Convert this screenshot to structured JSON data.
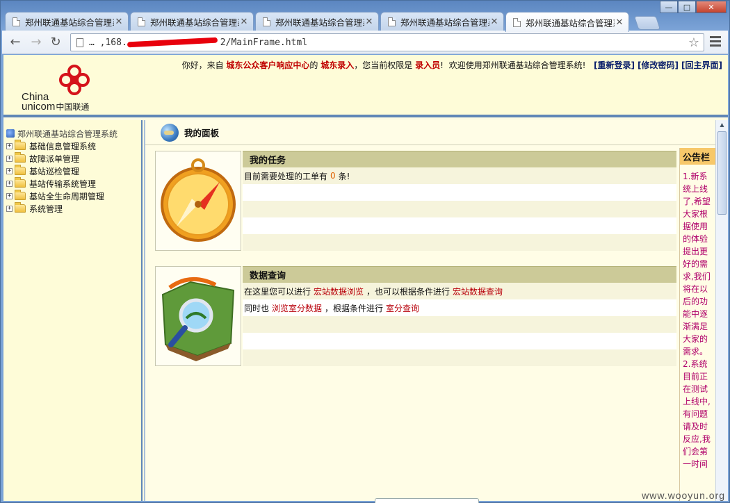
{
  "browser": {
    "tabs": [
      {
        "title": "郑州联通基站综合管理系"
      },
      {
        "title": "郑州联通基站综合管理系"
      },
      {
        "title": "郑州联通基站综合管理系"
      },
      {
        "title": "郑州联通基站综合管理系"
      },
      {
        "title": "郑州联通基站综合管理系"
      }
    ],
    "url_suffix": "2/MainFrame.html",
    "url_prefix": "…  ,168."
  },
  "header": {
    "logo_china": "China",
    "logo_unicom": "unicom",
    "logo_cn": "中国联通",
    "welcome_prefix": "你好，来自",
    "org": "城东公众客户响应中心",
    "of": "的",
    "dept": "城东录入",
    "perm_text": "，您当前权限是",
    "role": "录入员",
    "excl": "!",
    "welcome_sys": "欢迎使用郑州联通基站综合管理系统!",
    "links": [
      "[重新登录]",
      "[修改密码]",
      "[回主界面]"
    ]
  },
  "tree": {
    "root": "郑州联通基站综合管理系统",
    "items": [
      "基础信息管理系统",
      "故障派单管理",
      "基站巡检管理",
      "基站传输系统管理",
      "基站全生命周期管理",
      "系统管理"
    ]
  },
  "panel": {
    "title": "我的面板"
  },
  "tasks": {
    "heading": "我的任务",
    "line_prefix": "目前需要处理的工单有",
    "count": "0",
    "line_suffix": "条!"
  },
  "query": {
    "heading": "数据查询",
    "line1_prefix": "在这里您可以进行",
    "line1_link1": "宏站数据浏览",
    "line1_mid": "，也可以根据条件进行",
    "line1_link2": "宏站数据查询",
    "line2_prefix": "同时也",
    "line2_link1": "浏览室分数据",
    "line2_mid": "，根据条件进行",
    "line2_link2": "室分查询"
  },
  "notice": {
    "heading": "公告栏",
    "text": "1.新系统上线了,希望大家根据使用的体验提出更好的需求,我们将在以后的功能中逐渐满足大家的需求。2.系统目前正在测试上线中,有问题请及时反应,我们会第一时间"
  },
  "watermark": "www.wooyun.org"
}
